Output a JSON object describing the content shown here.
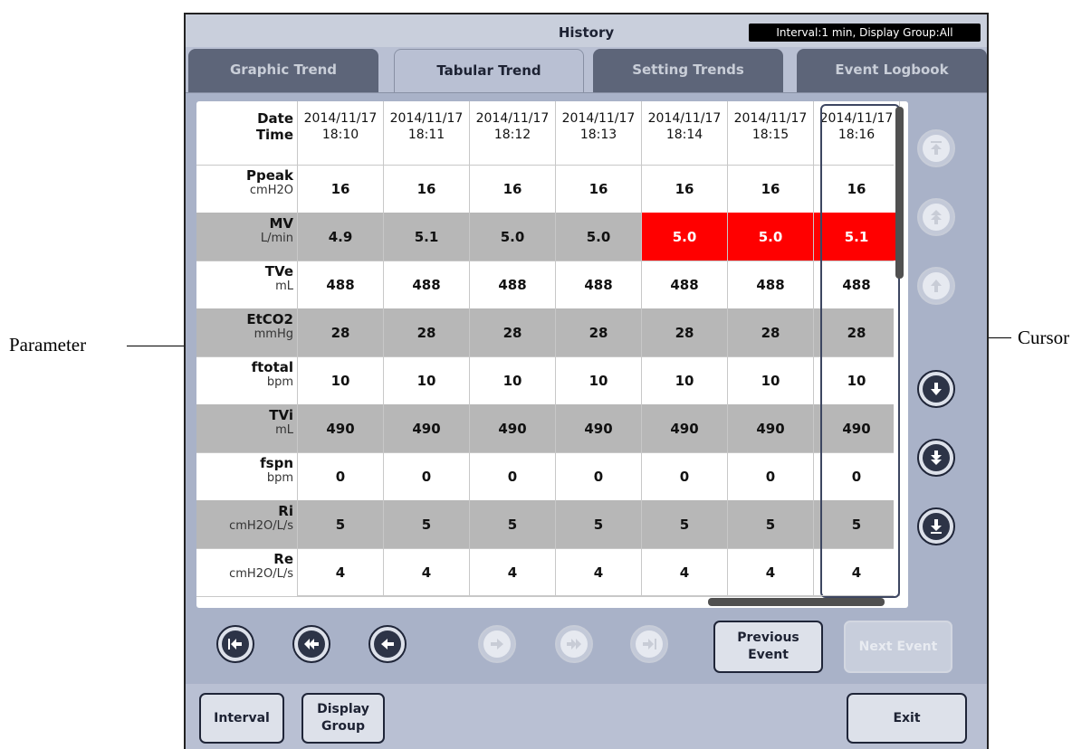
{
  "annotations": {
    "parameter": "Parameter",
    "cursor": "Cursor"
  },
  "window": {
    "title": "History",
    "info": "Interval:1 min, Display Group:All"
  },
  "tabs": [
    "Graphic Trend",
    "Tabular Trend",
    "Setting Trends",
    "Event Logbook"
  ],
  "active_tab": "Tabular Trend",
  "table": {
    "header": {
      "param_label_1": "Date",
      "param_label_2": "Time",
      "columns": [
        {
          "date": "2014/11/17",
          "time": "18:10"
        },
        {
          "date": "2014/11/17",
          "time": "18:11"
        },
        {
          "date": "2014/11/17",
          "time": "18:12"
        },
        {
          "date": "2014/11/17",
          "time": "18:13"
        },
        {
          "date": "2014/11/17",
          "time": "18:14"
        },
        {
          "date": "2014/11/17",
          "time": "18:15"
        },
        {
          "date": "2014/11/17",
          "time": "18:16"
        }
      ]
    },
    "rows": [
      {
        "name": "Ppeak",
        "unit": "cmH2O",
        "values": [
          "16",
          "16",
          "16",
          "16",
          "16",
          "16",
          "16"
        ],
        "alarm": [
          false,
          false,
          false,
          false,
          false,
          false,
          false
        ]
      },
      {
        "name": "MV",
        "unit": "L/min",
        "values": [
          "4.9",
          "5.1",
          "5.0",
          "5.0",
          "5.0",
          "5.0",
          "5.1"
        ],
        "alarm": [
          false,
          false,
          false,
          false,
          true,
          true,
          true
        ]
      },
      {
        "name": "TVe",
        "unit": "mL",
        "values": [
          "488",
          "488",
          "488",
          "488",
          "488",
          "488",
          "488"
        ],
        "alarm": [
          false,
          false,
          false,
          false,
          false,
          false,
          false
        ]
      },
      {
        "name": "EtCO2",
        "unit": "mmHg",
        "values": [
          "28",
          "28",
          "28",
          "28",
          "28",
          "28",
          "28"
        ],
        "alarm": [
          false,
          false,
          false,
          false,
          false,
          false,
          false
        ]
      },
      {
        "name": "ftotal",
        "unit": "bpm",
        "values": [
          "10",
          "10",
          "10",
          "10",
          "10",
          "10",
          "10"
        ],
        "alarm": [
          false,
          false,
          false,
          false,
          false,
          false,
          false
        ]
      },
      {
        "name": "TVi",
        "unit": "mL",
        "values": [
          "490",
          "490",
          "490",
          "490",
          "490",
          "490",
          "490"
        ],
        "alarm": [
          false,
          false,
          false,
          false,
          false,
          false,
          false
        ]
      },
      {
        "name": "fspn",
        "unit": "bpm",
        "values": [
          "0",
          "0",
          "0",
          "0",
          "0",
          "0",
          "0"
        ],
        "alarm": [
          false,
          false,
          false,
          false,
          false,
          false,
          false
        ]
      },
      {
        "name": "Ri",
        "unit": "cmH2O/L/s",
        "values": [
          "5",
          "5",
          "5",
          "5",
          "5",
          "5",
          "5"
        ],
        "alarm": [
          false,
          false,
          false,
          false,
          false,
          false,
          false
        ]
      },
      {
        "name": "Re",
        "unit": "cmH2O/L/s",
        "values": [
          "4",
          "4",
          "4",
          "4",
          "4",
          "4",
          "4"
        ],
        "alarm": [
          false,
          false,
          false,
          false,
          false,
          false,
          false
        ]
      }
    ]
  },
  "buttons": {
    "previous_event": "Previous Event",
    "next_event": "Next Event",
    "interval": "Interval",
    "display_group": "Display Group",
    "exit": "Exit"
  },
  "icons": {
    "scroll_top": "double-up-bar-icon",
    "page_up": "double-up-icon",
    "line_up": "up-icon",
    "line_down": "down-icon",
    "page_down": "double-down-icon",
    "scroll_bottom": "down-bar-icon",
    "first": "left-bar-icon",
    "page_left": "double-left-icon",
    "left": "left-icon",
    "right": "right-icon",
    "page_right": "double-right-icon",
    "last": "right-bar-icon"
  },
  "colors": {
    "alarm": "#ff0000",
    "alt_row": "#b7b7b7",
    "tab_inactive": "#5d6579"
  }
}
